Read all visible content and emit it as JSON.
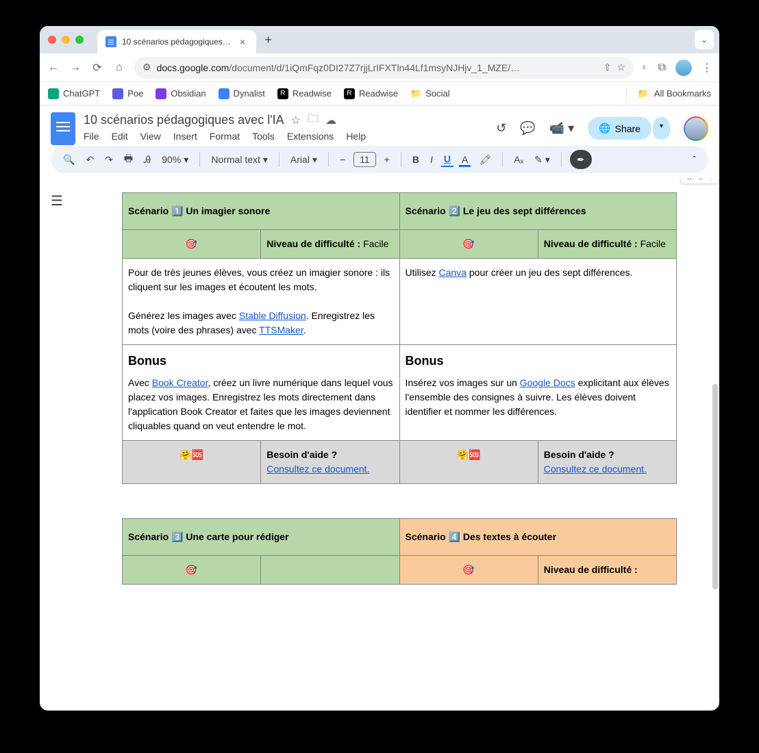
{
  "browser": {
    "tab_title": "10 scénarios pédagogiques a…",
    "url_domain": "docs.google.com",
    "url_path": "/document/d/1iQmFqz0DI27Z7rjjLrIFXTln44Lf1msyNJHjv_1_MZE/…",
    "bookmarks": [
      "ChatGPT",
      "Poe",
      "Obsidian",
      "Dynalist",
      "Readwise",
      "Readwise",
      "Social"
    ],
    "all_bookmarks": "All Bookmarks"
  },
  "docs": {
    "title": "10 scénarios pédagogiques avec l'IA",
    "menu": [
      "File",
      "Edit",
      "View",
      "Insert",
      "Format",
      "Tools",
      "Extensions",
      "Help"
    ],
    "share": "Share",
    "toolbar": {
      "zoom": "90%",
      "style": "Normal text",
      "font": "Arial",
      "size": "11"
    }
  },
  "content": {
    "s1": {
      "title": "Scénario 1️⃣ Un imagier sonore",
      "diff_label": "Niveau de difficulté :",
      "diff_val": "Facile",
      "p1": "Pour de très jeunes élèves, vous créez un imagier sonore : ils cliquent sur les images et écoutent les mots.",
      "p2a": "Générez les images avec ",
      "link2": "Stable Diffusion",
      "p2b": ". Enregistrez les mots (voire des phrases) avec ",
      "link3": "TTSMaker",
      "p2c": ".",
      "bonus": "Bonus",
      "bp1a": "Avec ",
      "blink": "Book Creator",
      "bp1b": ", créez un livre numérique dans lequel vous placez vos images. Enregistrez les mots directement dans l'application Book Creator et faites que les images deviennent cliquables quand on veut entendre le mot.",
      "help": "Besoin d'aide ?",
      "help_link": "Consultez ce document."
    },
    "s2": {
      "title": "Scénario 2️⃣ Le jeu des sept différences",
      "diff_label": "Niveau de difficulté :",
      "diff_val": "Facile",
      "p1a": "Utilisez ",
      "link1": "Canva",
      "p1b": " pour créer un jeu des sept différences.",
      "bonus": "Bonus",
      "bp1a": "Insérez vos images sur un ",
      "blink": "Google Docs",
      "bp1b": " explicitant aux élèves l'ensemble des consignes à suivre. Les élèves doivent identifier et nommer les différences.",
      "help": "Besoin d'aide ?",
      "help_link": "Consultez ce document."
    },
    "s3": {
      "title": "Scénario 3️⃣ Une carte pour rédiger"
    },
    "s4": {
      "title": "Scénario 4️⃣ Des textes à écouter",
      "diff_label": "Niveau de difficulté :"
    }
  }
}
